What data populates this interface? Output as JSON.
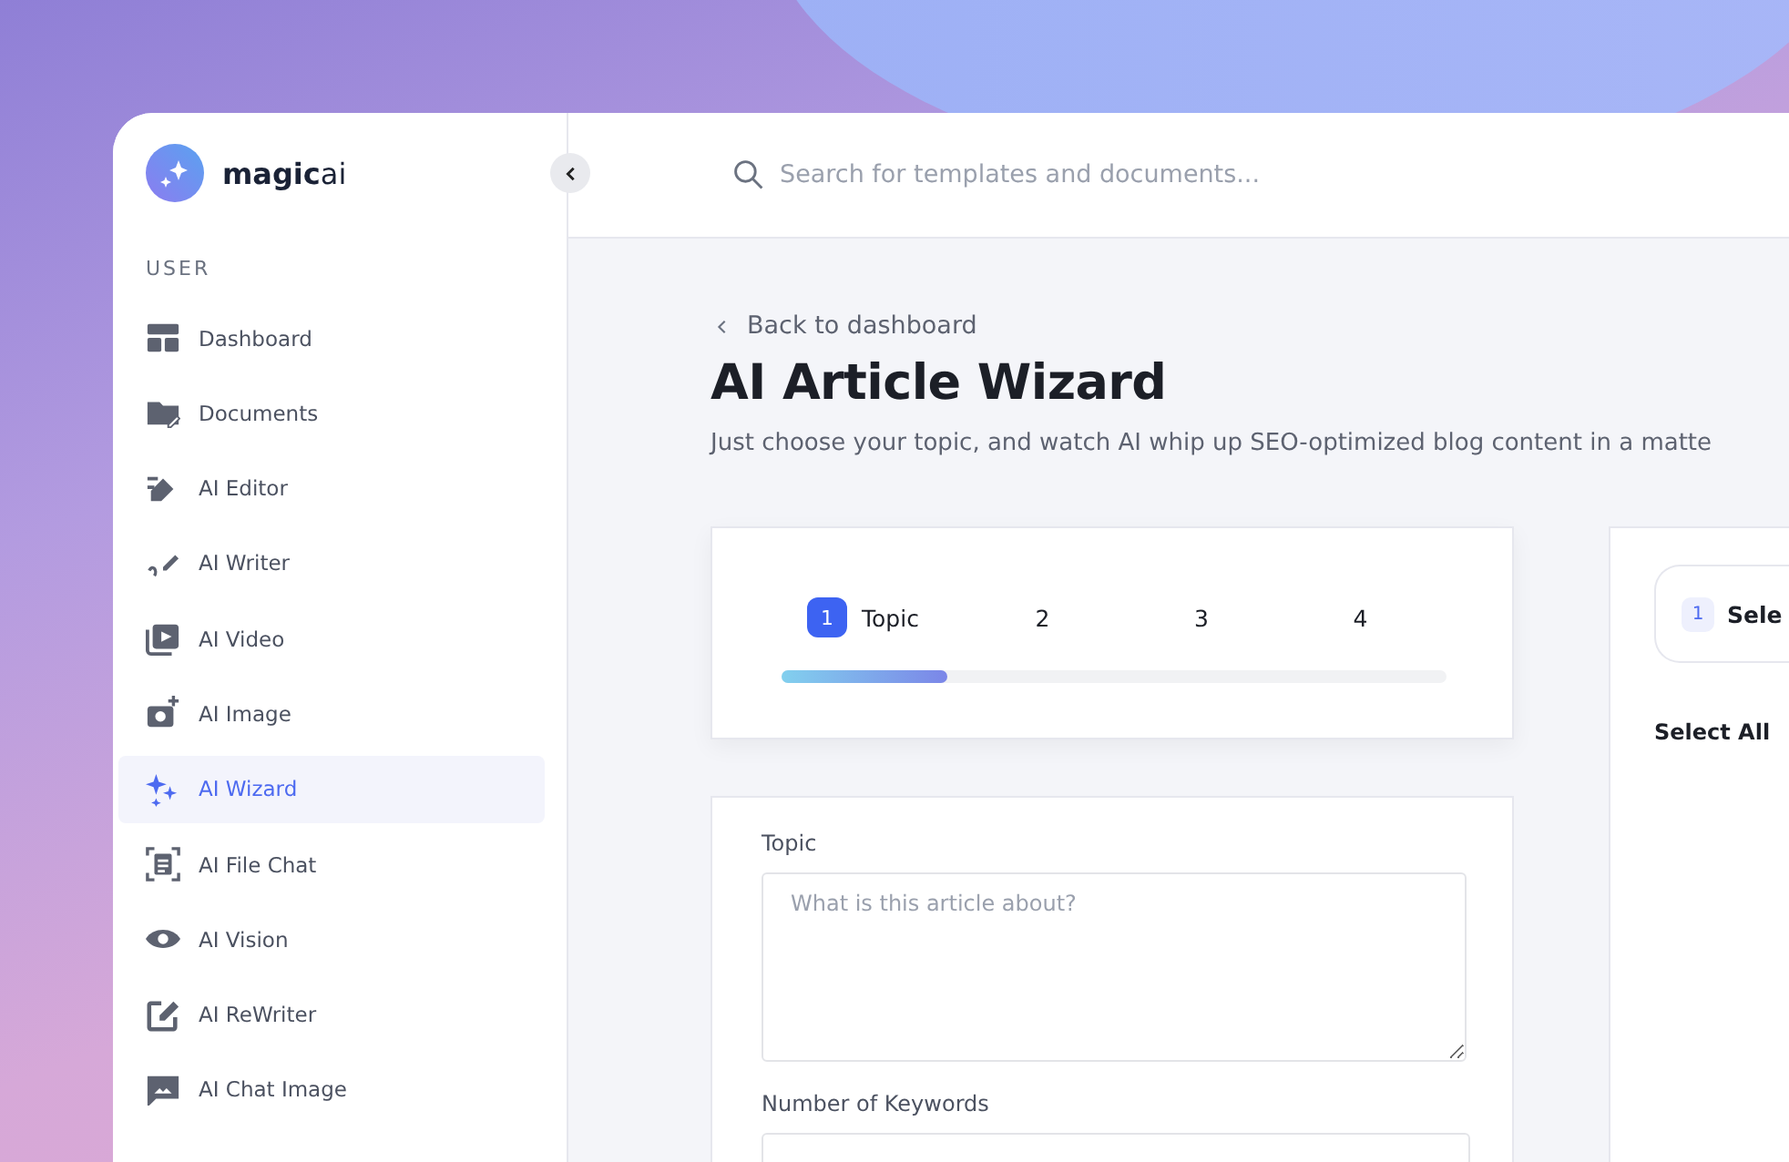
{
  "brand": {
    "name_bold": "magic",
    "name_light": "ai"
  },
  "sidebar": {
    "section": "USER",
    "items": [
      {
        "label": "Dashboard",
        "selected": false
      },
      {
        "label": "Documents",
        "selected": false
      },
      {
        "label": "AI Editor",
        "selected": false
      },
      {
        "label": "AI Writer",
        "selected": false
      },
      {
        "label": "AI Video",
        "selected": false
      },
      {
        "label": "AI Image",
        "selected": false
      },
      {
        "label": "AI Wizard",
        "selected": true
      },
      {
        "label": "AI File Chat",
        "selected": false
      },
      {
        "label": "AI Vision",
        "selected": false
      },
      {
        "label": "AI ReWriter",
        "selected": false
      },
      {
        "label": "AI Chat Image",
        "selected": false
      }
    ]
  },
  "search": {
    "placeholder": "Search for templates and documents..."
  },
  "back_link": "Back to dashboard",
  "title": "AI Article Wizard",
  "subtitle": "Just choose your topic, and watch AI whip up SEO-optimized blog content in a matte",
  "steps": {
    "items": [
      {
        "number": "1",
        "label": "Topic",
        "selected": true
      },
      {
        "number": "2",
        "selected": false
      },
      {
        "number": "3",
        "selected": false
      },
      {
        "number": "4",
        "selected": false
      }
    ],
    "level": 0.25
  },
  "form": {
    "fields": [
      {
        "label": "Topic",
        "placeholder": "What is this article about?"
      },
      {
        "label": "Number of Keywords"
      }
    ]
  },
  "right_panel": {
    "step_number": "1",
    "step_label": "Sele",
    "select_all": "Select All"
  }
}
